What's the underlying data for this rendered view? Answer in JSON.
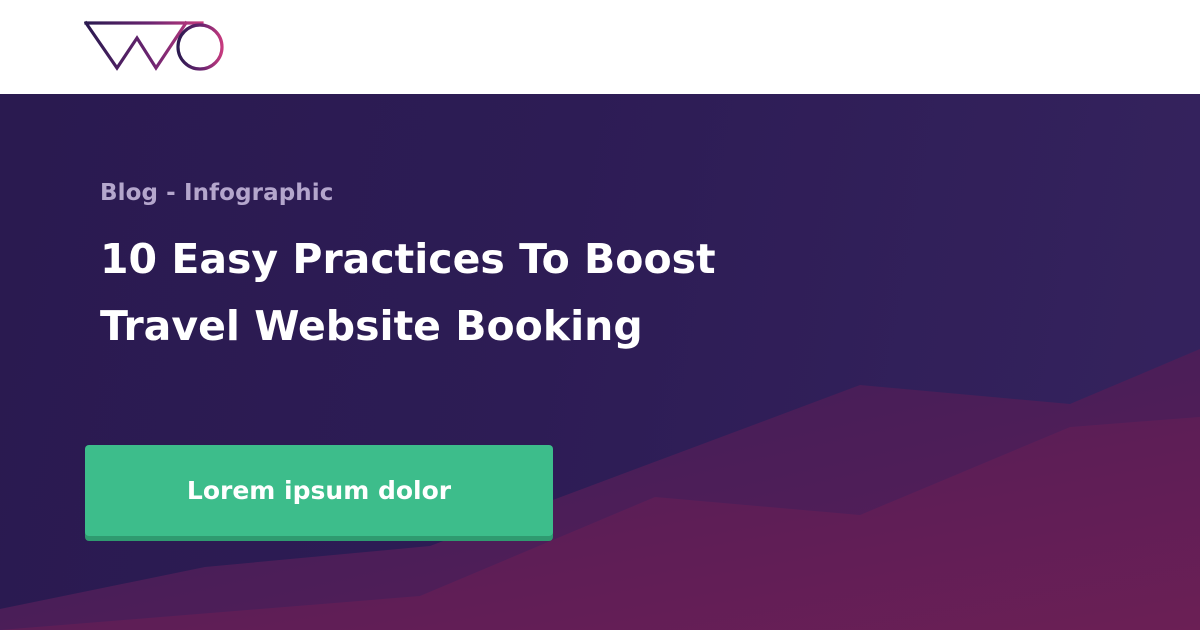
{
  "header": {
    "logo_name": "vwo-logo"
  },
  "hero": {
    "category": "Blog - Infographic",
    "title": "10 Easy Practices To Boost Travel Website Booking",
    "cta_label": "Lorem ipsum dolor"
  },
  "colors": {
    "hero_background": "#2b1a52",
    "cta": "#3dbd8b",
    "cta_shadow": "#2f9a70",
    "mountain_back": "#4a1f5c",
    "mountain_front": "#621e55",
    "category_text": "#b4a6cc",
    "logo_navy": "#2b1a50",
    "logo_magenta": "#c63a7e"
  }
}
